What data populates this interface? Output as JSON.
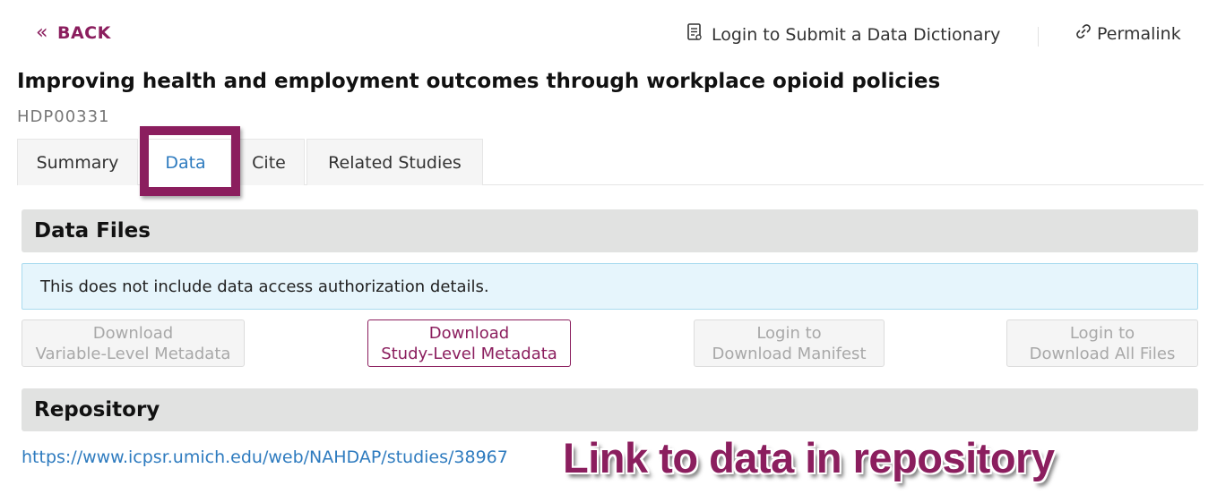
{
  "header": {
    "back_label": "BACK",
    "login_dictionary_label": "Login to Submit a Data Dictionary",
    "permalink_label": "Permalink"
  },
  "study": {
    "title": "Improving health and employment outcomes through workplace opioid policies",
    "id": "HDP00331"
  },
  "tabs": [
    {
      "label": "Summary",
      "active": false
    },
    {
      "label": "Data",
      "active": true
    },
    {
      "label": "Cite",
      "active": false
    },
    {
      "label": "Related Studies",
      "active": false
    }
  ],
  "data_files": {
    "heading": "Data Files",
    "notice": "This does not include data access authorization details.",
    "buttons": [
      {
        "line1": "Download",
        "line2": "Variable-Level Metadata",
        "enabled": false
      },
      {
        "line1": "Download",
        "line2": "Study-Level Metadata",
        "enabled": true
      },
      {
        "line1": "Login to",
        "line2": "Download Manifest",
        "enabled": false
      },
      {
        "line1": "Login to",
        "line2": "Download All Files",
        "enabled": false
      }
    ]
  },
  "repository": {
    "heading": "Repository",
    "url": "https://www.icpsr.umich.edu/web/NAHDAP/studies/38967"
  },
  "annotation": {
    "callout_text": "Link to data in repository",
    "color": "#8b1e5e"
  },
  "colors": {
    "brand": "#8b1e5e",
    "link": "#2e7bbf",
    "notice_bg": "#e6f5fc"
  },
  "icons": {
    "back": "double-chevron-left-icon",
    "dictionary": "document-icon",
    "permalink": "link-icon"
  }
}
